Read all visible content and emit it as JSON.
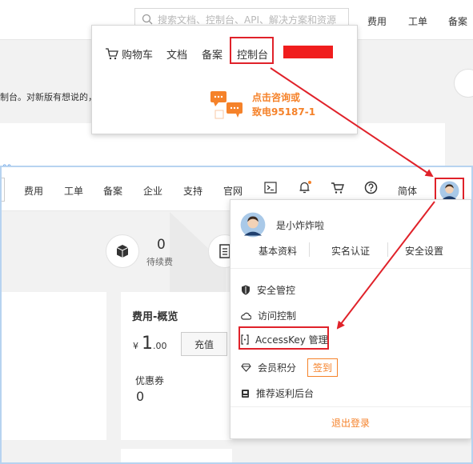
{
  "background_header": {
    "search_placeholder": "搜索文档、控制台、API、解决方案和资源",
    "nav": [
      "费用",
      "工单",
      "备案"
    ],
    "notice": "制台。对新版有想说的，"
  },
  "top_popup": {
    "items": [
      "购物车",
      "文档",
      "备案",
      "控制台"
    ],
    "consult_line1": "点击咨询或",
    "consult_line2": "致电95187-1"
  },
  "topbar": {
    "items": [
      "费用",
      "工单",
      "备案",
      "企业",
      "支持",
      "官网"
    ],
    "lang": "简体"
  },
  "stats": {
    "pending_value": "0",
    "pending_label": "待续费"
  },
  "cost_card": {
    "title": "费用-概览",
    "currency": "¥",
    "amount_int": "1",
    "amount_dec": ".00",
    "recharge_label": "充值",
    "coupon_label": "优惠券",
    "coupon_value": "0"
  },
  "dropdown": {
    "username": "是小炸炸啦",
    "links": [
      "基本资料",
      "实名认证",
      "安全设置"
    ],
    "menu": [
      "安全管控",
      "访问控制",
      "AccessKey 管理",
      "会员积分",
      "推荐返利后台"
    ],
    "signin_label": "签到",
    "logout_label": "退出登录"
  },
  "colors": {
    "accent_orange": "#f5822a",
    "highlight_red": "#e0222a",
    "frame_blue": "#b7d3f0"
  }
}
